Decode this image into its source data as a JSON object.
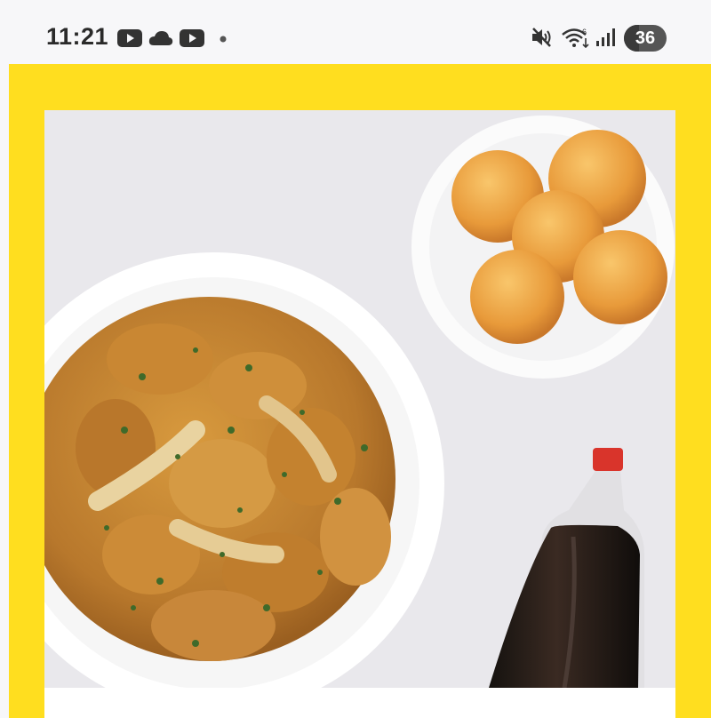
{
  "status_bar": {
    "time": "11:21",
    "notification_icons": [
      "youtube-icon",
      "cloud-icon",
      "youtube-icon",
      "dot-icon"
    ],
    "system_icons": [
      "mute-icon",
      "wifi-icon",
      "signal-icon"
    ],
    "battery_level": "36",
    "battery_fraction": 0.36
  },
  "banner": {
    "background_color": "#ffde1f",
    "photo_items": [
      "fried-chicken-plate",
      "cheese-ball-plate",
      "cola-bottle"
    ]
  }
}
